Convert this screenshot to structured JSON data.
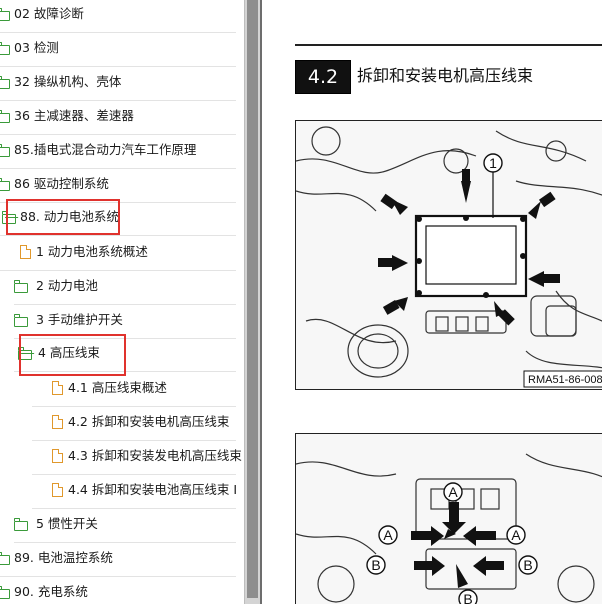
{
  "toc": {
    "items": [
      {
        "label": "02 故障诊断",
        "icon": "folder-icon"
      },
      {
        "label": "03 检测",
        "icon": "folder-icon"
      },
      {
        "label": "32 操纵机构、壳体",
        "icon": "folder-icon"
      },
      {
        "label": "36 主减速器、差速器",
        "icon": "folder-icon"
      },
      {
        "label": "85.插电式混合动力汽车工作原理",
        "icon": "folder-icon"
      },
      {
        "label": "86 驱动控制系统",
        "icon": "folder-icon"
      },
      {
        "label": "88. 动力电池系统",
        "icon": "folder-open-icon"
      },
      {
        "label": "1 动力电池系统概述",
        "icon": "document-icon"
      },
      {
        "label": "2 动力电池",
        "icon": "folder-icon"
      },
      {
        "label": "3 手动维护开关",
        "icon": "folder-icon"
      },
      {
        "label": "4 高压线束",
        "icon": "folder-open-icon"
      },
      {
        "label": "4.1 高压线束概述",
        "icon": "document-icon"
      },
      {
        "label": "4.2 拆卸和安装电机高压线束",
        "icon": "document-icon"
      },
      {
        "label": "4.3 拆卸和安装发电机高压线束",
        "icon": "document-icon"
      },
      {
        "label": "4.4 拆卸和安装电池高压线束 I",
        "icon": "document-icon"
      },
      {
        "label": "5 惯性开关",
        "icon": "folder-icon"
      },
      {
        "label": "89. 电池温控系统",
        "icon": "folder-icon"
      },
      {
        "label": "90. 充电系统",
        "icon": "folder-icon"
      }
    ]
  },
  "document": {
    "section_number": "4.2",
    "section_title": "拆卸和安装电机高压线束",
    "figure1": {
      "callout": "1",
      "label": "RMA51-86-008"
    },
    "figure2": {
      "callouts": [
        "A",
        "A",
        "A",
        "A",
        "B",
        "B",
        "B",
        "B"
      ]
    }
  },
  "colors": {
    "highlight": "#e0322d",
    "folder": "#3a9a3a",
    "document": "#e0982c"
  }
}
